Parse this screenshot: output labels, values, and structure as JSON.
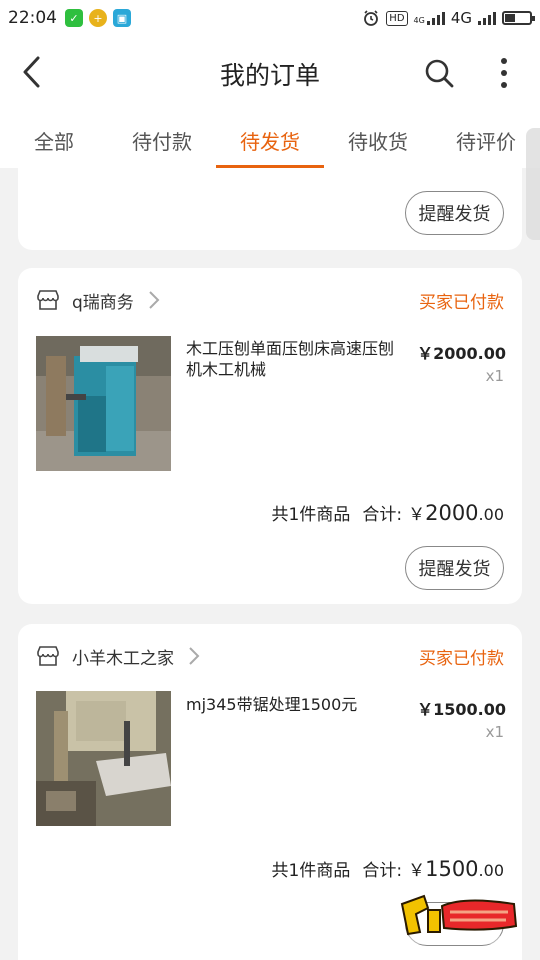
{
  "status_bar": {
    "time": "22:04",
    "hd": "HD",
    "g4small": "4G",
    "network": "4G"
  },
  "header": {
    "title": "我的订单"
  },
  "tabs": [
    {
      "label": "全部"
    },
    {
      "label": "待付款"
    },
    {
      "label": "待发货",
      "active": true
    },
    {
      "label": "待收货"
    },
    {
      "label": "待评价"
    }
  ],
  "orders": [
    {
      "remind_label": "提醒发货"
    },
    {
      "shop_name": "q瑞商务",
      "status": "买家已付款",
      "product_title": "木工压刨单面压刨床高速压刨机木工机械",
      "price": "￥2000.00",
      "qty": "x1",
      "count_label": "共1件商品",
      "total_label": "合计:",
      "currency": "￥",
      "total_int": "2000",
      "total_dec": ".00",
      "remind_label": "提醒发货"
    },
    {
      "shop_name": "小羊木工之家",
      "status": "买家已付款",
      "product_title": "mj345带锯处理1500元",
      "price": "￥1500.00",
      "qty": "x1",
      "count_label": "共1件商品",
      "total_label": "合计:",
      "currency": "￥",
      "total_int": "1500",
      "total_dec": ".00"
    }
  ],
  "watermark": {
    "text": "木工爱好者"
  },
  "colors": {
    "accent": "#e8630f",
    "background": "#f2f2f2"
  },
  "icons": [
    "back-icon",
    "search-icon",
    "more-icon",
    "shop-icon",
    "chevron-right-icon",
    "wechat-icon",
    "alarm-icon",
    "battery-icon"
  ]
}
